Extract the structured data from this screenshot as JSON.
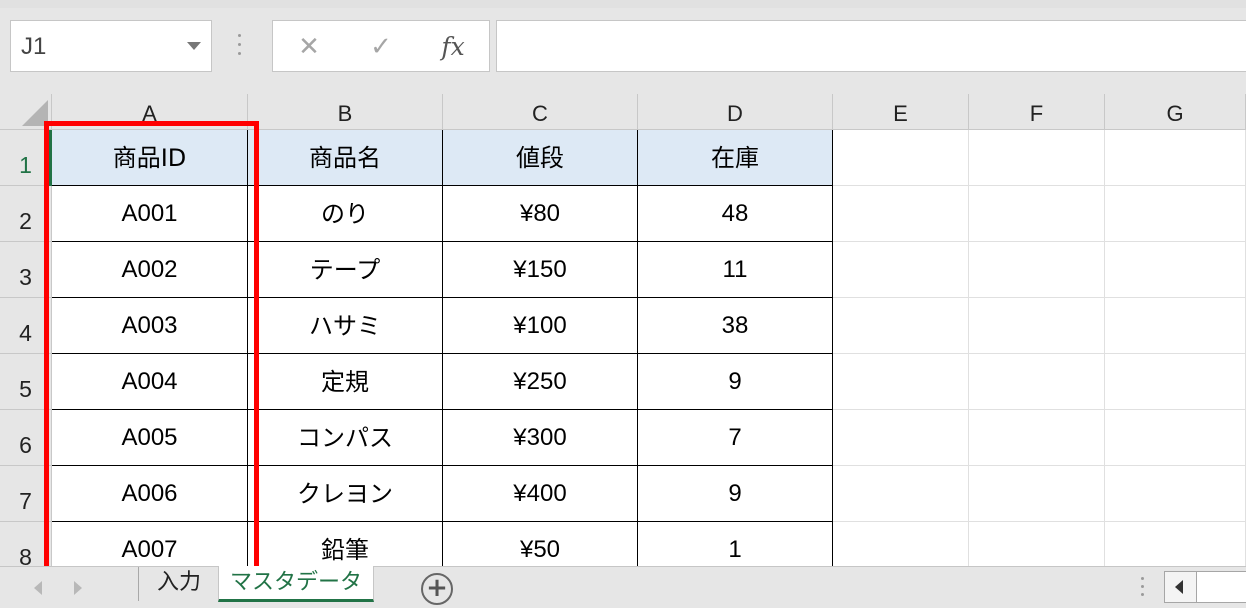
{
  "formula_bar": {
    "name_box": "J1",
    "cancel_symbol": "✕",
    "enter_symbol": "✓",
    "fx_symbol": "fx",
    "formula": ""
  },
  "columns": [
    "A",
    "B",
    "C",
    "D",
    "E",
    "F",
    "G"
  ],
  "rows": [
    "1",
    "2",
    "3",
    "4",
    "5",
    "6",
    "7",
    "8"
  ],
  "active_row": "1",
  "table": {
    "headers": [
      "商品ID",
      "商品名",
      "値段",
      "在庫"
    ],
    "rows": [
      [
        "A001",
        "のり",
        "¥80",
        "48"
      ],
      [
        "A002",
        "テープ",
        "¥150",
        "11"
      ],
      [
        "A003",
        "ハサミ",
        "¥100",
        "38"
      ],
      [
        "A004",
        "定規",
        "¥250",
        "9"
      ],
      [
        "A005",
        "コンパス",
        "¥300",
        "7"
      ],
      [
        "A006",
        "クレヨン",
        "¥400",
        "9"
      ],
      [
        "A007",
        "鉛筆",
        "¥50",
        "1"
      ]
    ]
  },
  "colors": {
    "header_fill": "#dde9f5",
    "highlight": "#ff0000",
    "excel_green": "#217346"
  },
  "sheets": {
    "tabs": [
      "入力",
      "マスタデータ"
    ],
    "active": "マスタデータ",
    "add_symbol": "+"
  }
}
